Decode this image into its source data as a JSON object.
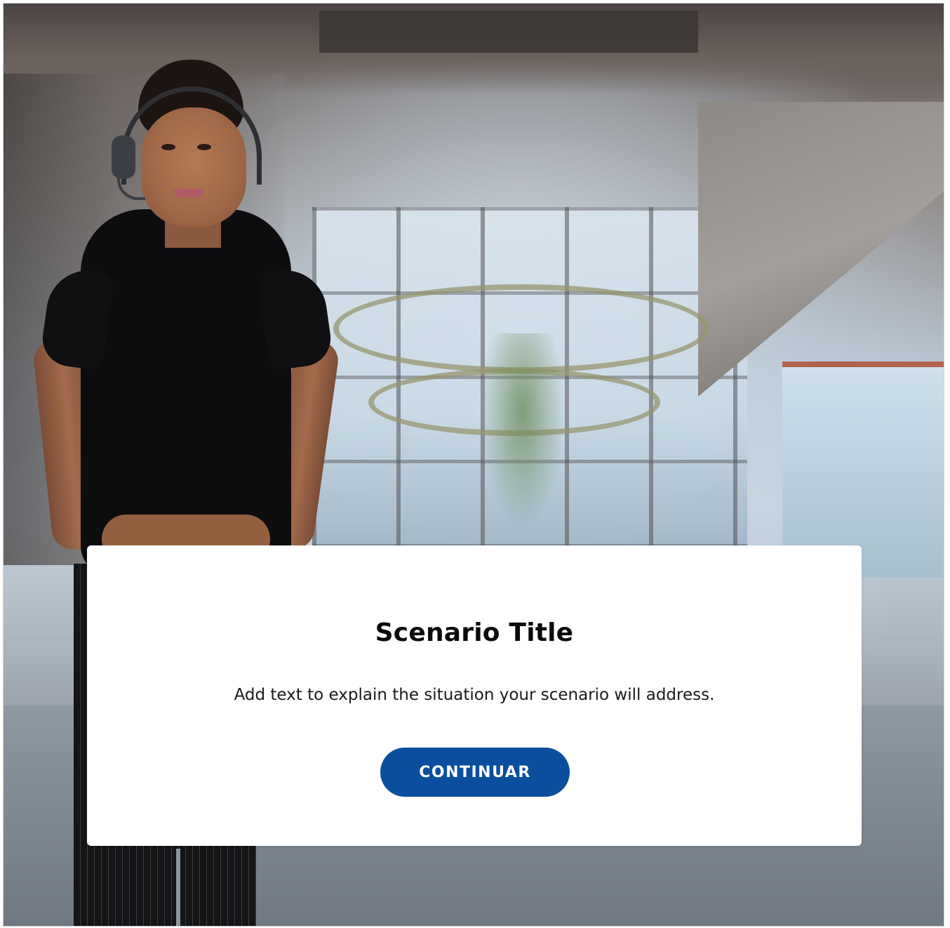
{
  "scenario": {
    "title": "Scenario Title",
    "description": "Add text to explain the situation your scenario will address.",
    "continue_label": "CONTINUAR"
  },
  "colors": {
    "button_background": "#0b4e9e",
    "button_text": "#ffffff",
    "card_background": "#ffffff",
    "title_text": "#0b0b0b"
  },
  "background": {
    "scene": "office-interior-photo",
    "character": "woman-with-headset"
  }
}
